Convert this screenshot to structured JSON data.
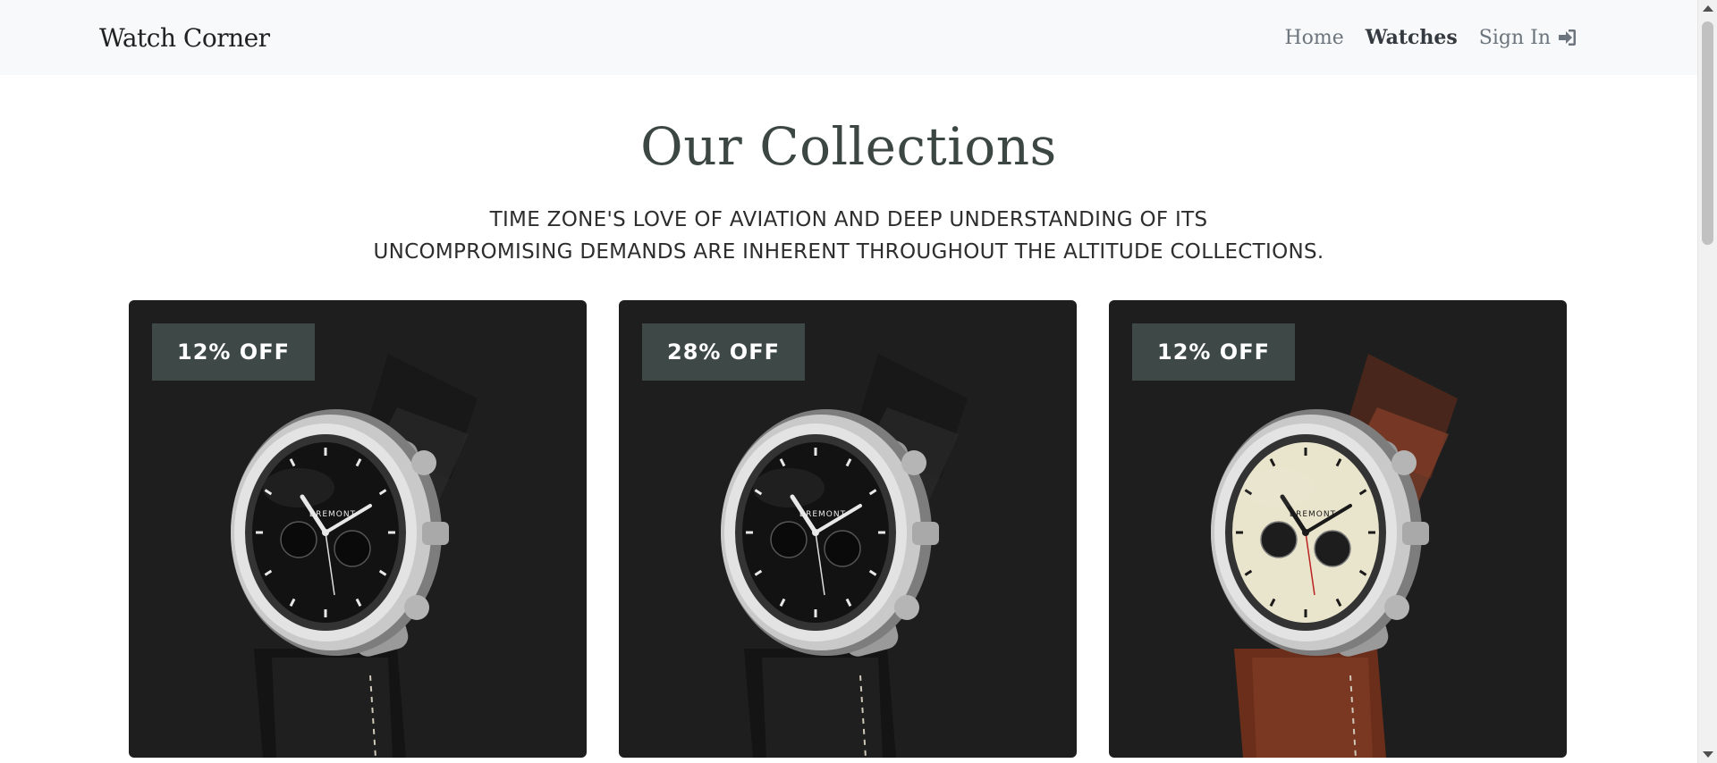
{
  "navbar": {
    "brand": "Watch Corner",
    "links": [
      {
        "label": "Home",
        "active": false
      },
      {
        "label": "Watches",
        "active": true
      },
      {
        "label": "Sign In",
        "active": false,
        "icon": "sign-in-icon"
      }
    ]
  },
  "main": {
    "title": "Our Collections",
    "subtitle_line1": "TIME ZONE'S LOVE OF AVIATION AND DEEP UNDERSTANDING OF ITS",
    "subtitle_line2": "UNCOMPROMISING DEMANDS ARE INHERENT THROUGHOUT THE ALTITUDE COLLECTIONS."
  },
  "products": [
    {
      "badge": "12% OFF",
      "dial": "black",
      "strap": "black",
      "brand_mark": "BREMONT"
    },
    {
      "badge": "28% OFF",
      "dial": "black",
      "strap": "black",
      "brand_mark": "BREMONT"
    },
    {
      "badge": "12% OFF",
      "dial": "cream",
      "strap": "brown",
      "brand_mark": "BREMONT"
    }
  ],
  "colors": {
    "navbar_bg": "#f8f9fa",
    "card_bg": "#1e1e1e",
    "badge_bg": "#3e4847",
    "heading": "#3c4743"
  }
}
